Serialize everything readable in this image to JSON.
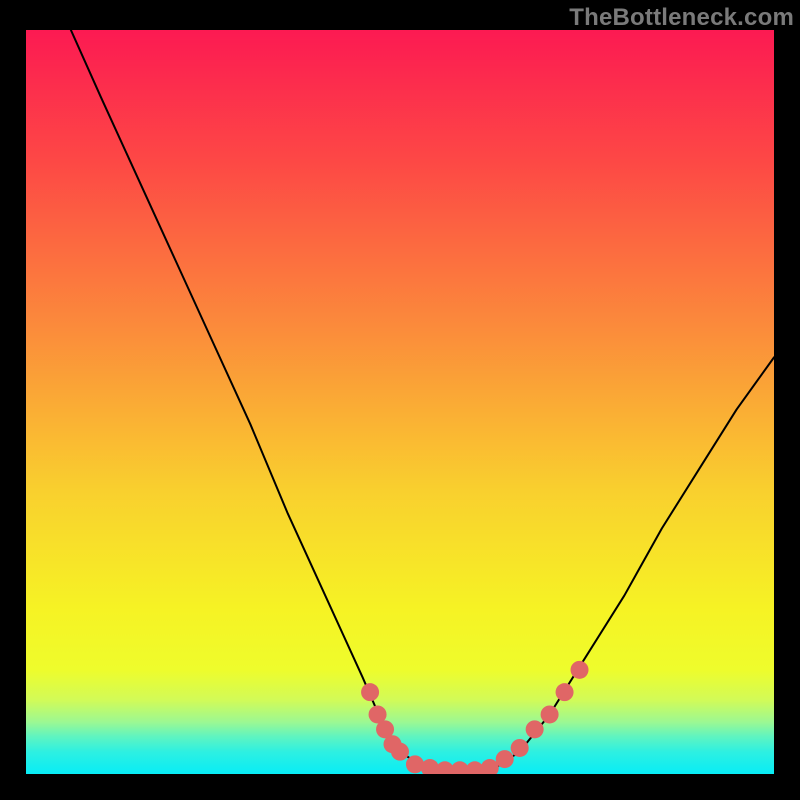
{
  "attribution": "TheBottleneck.com",
  "chart_data": {
    "type": "line",
    "title": "",
    "xlabel": "",
    "ylabel": "",
    "xlim": [
      0,
      100
    ],
    "ylim": [
      0,
      100
    ],
    "curve": {
      "name": "bottleneck-curve",
      "color": "#000000",
      "stroke_width": 2,
      "points": [
        {
          "x": 6,
          "y": 100
        },
        {
          "x": 10,
          "y": 91
        },
        {
          "x": 15,
          "y": 80
        },
        {
          "x": 20,
          "y": 69
        },
        {
          "x": 25,
          "y": 58
        },
        {
          "x": 30,
          "y": 47
        },
        {
          "x": 35,
          "y": 35
        },
        {
          "x": 40,
          "y": 24
        },
        {
          "x": 45,
          "y": 13
        },
        {
          "x": 48,
          "y": 6
        },
        {
          "x": 50,
          "y": 3
        },
        {
          "x": 53,
          "y": 1
        },
        {
          "x": 56,
          "y": 0.5
        },
        {
          "x": 60,
          "y": 0.5
        },
        {
          "x": 63,
          "y": 1
        },
        {
          "x": 66,
          "y": 3
        },
        {
          "x": 70,
          "y": 8
        },
        {
          "x": 75,
          "y": 16
        },
        {
          "x": 80,
          "y": 24
        },
        {
          "x": 85,
          "y": 33
        },
        {
          "x": 90,
          "y": 41
        },
        {
          "x": 95,
          "y": 49
        },
        {
          "x": 100,
          "y": 56
        }
      ]
    },
    "highlight_dots": {
      "name": "highlight-range",
      "color": "#e06666",
      "radius": 9,
      "points": [
        {
          "x": 46,
          "y": 11
        },
        {
          "x": 47,
          "y": 8
        },
        {
          "x": 48,
          "y": 6
        },
        {
          "x": 49,
          "y": 4
        },
        {
          "x": 50,
          "y": 3
        },
        {
          "x": 52,
          "y": 1.3
        },
        {
          "x": 54,
          "y": 0.8
        },
        {
          "x": 56,
          "y": 0.5
        },
        {
          "x": 58,
          "y": 0.5
        },
        {
          "x": 60,
          "y": 0.5
        },
        {
          "x": 62,
          "y": 0.8
        },
        {
          "x": 64,
          "y": 2
        },
        {
          "x": 66,
          "y": 3.5
        },
        {
          "x": 68,
          "y": 6
        },
        {
          "x": 70,
          "y": 8
        },
        {
          "x": 72,
          "y": 11
        },
        {
          "x": 74,
          "y": 14
        }
      ]
    },
    "background_gradient": {
      "stops": [
        {
          "offset": 0,
          "color": "#fc1a52"
        },
        {
          "offset": 18,
          "color": "#fd4945"
        },
        {
          "offset": 40,
          "color": "#fb8b3b"
        },
        {
          "offset": 62,
          "color": "#f9d02e"
        },
        {
          "offset": 78,
          "color": "#f6f324"
        },
        {
          "offset": 86,
          "color": "#eefc2c"
        },
        {
          "offset": 90,
          "color": "#d2fb57"
        },
        {
          "offset": 93,
          "color": "#9cf892"
        },
        {
          "offset": 95,
          "color": "#5ef4c1"
        },
        {
          "offset": 97,
          "color": "#2ef0e1"
        },
        {
          "offset": 100,
          "color": "#08edf6"
        }
      ]
    }
  }
}
